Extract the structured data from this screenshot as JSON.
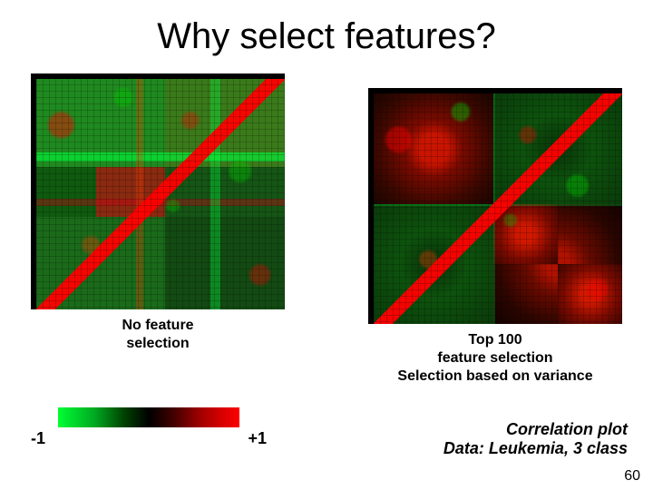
{
  "title": "Why select features?",
  "left_caption_line1": "No feature",
  "left_caption_line2": "selection",
  "right_caption_line1": "Top 100",
  "right_caption_line2": "feature selection",
  "right_caption_line3": "Selection based on variance",
  "legend": {
    "min_label": "-1",
    "max_label": "+1"
  },
  "footnote_line1": "Correlation plot",
  "footnote_line2": "Data: Leukemia, 3 class",
  "page_number": "60",
  "chart_data": {
    "type": "heatmap",
    "description": "Two sample-by-sample correlation heatmaps; left uses all features, right uses top-100 by variance. Color scale maps correlation -1 (green) .. 0 (black) .. +1 (red). Right plot shows clearer ~2x2 block structure (3-class Leukemia).",
    "colorscale": {
      "min": -1,
      "mid": 0,
      "max": 1,
      "min_color": "#00ff33",
      "mid_color": "#000000",
      "max_color": "#ff0000"
    },
    "panels": [
      {
        "name": "No feature selection",
        "clusters_visible": "weak"
      },
      {
        "name": "Top 100 feature selection",
        "clusters_visible": "strong",
        "approx_block_split": 0.48
      }
    ]
  }
}
